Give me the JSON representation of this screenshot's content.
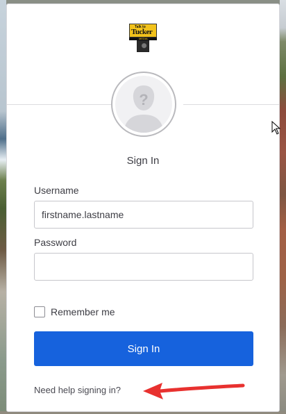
{
  "logo": {
    "line1": "Talk to",
    "line2": "Tucker",
    "line3": "MEDIA"
  },
  "form": {
    "title": "Sign In",
    "username_label": "Username",
    "username_value": "firstname.lastname",
    "password_label": "Password",
    "password_value": "",
    "remember_label": "Remember me",
    "remember_checked": false,
    "submit_label": "Sign In",
    "help_link": "Need help signing in?"
  },
  "colors": {
    "primary_button": "#1662dd",
    "annotation_arrow": "#e8312f"
  }
}
